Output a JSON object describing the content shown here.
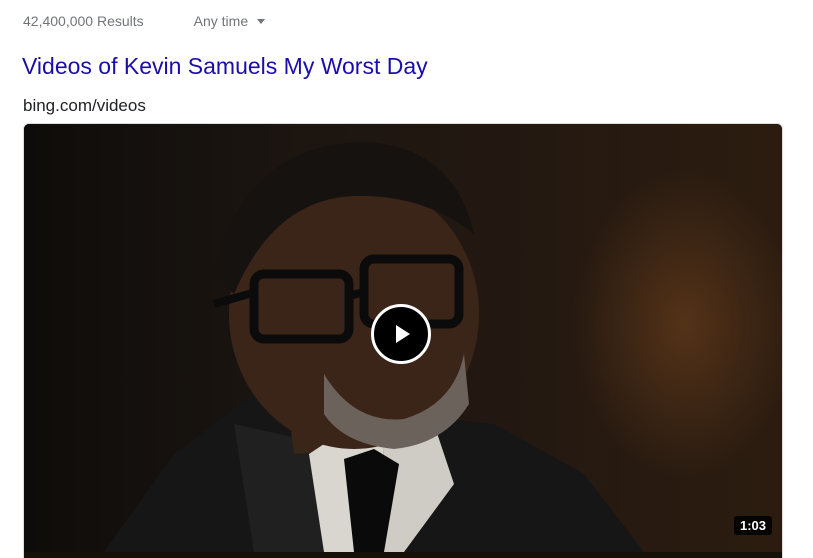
{
  "toolbar": {
    "results_count": "42,400,000 Results",
    "time_filter": "Any time",
    "time_filter_icon": "caret-down-icon"
  },
  "result": {
    "title": "Videos of Kevin Samuels My Worst Day",
    "source": "bing.com/videos"
  },
  "video": {
    "duration": "1:03",
    "play_icon": "play-icon"
  }
}
